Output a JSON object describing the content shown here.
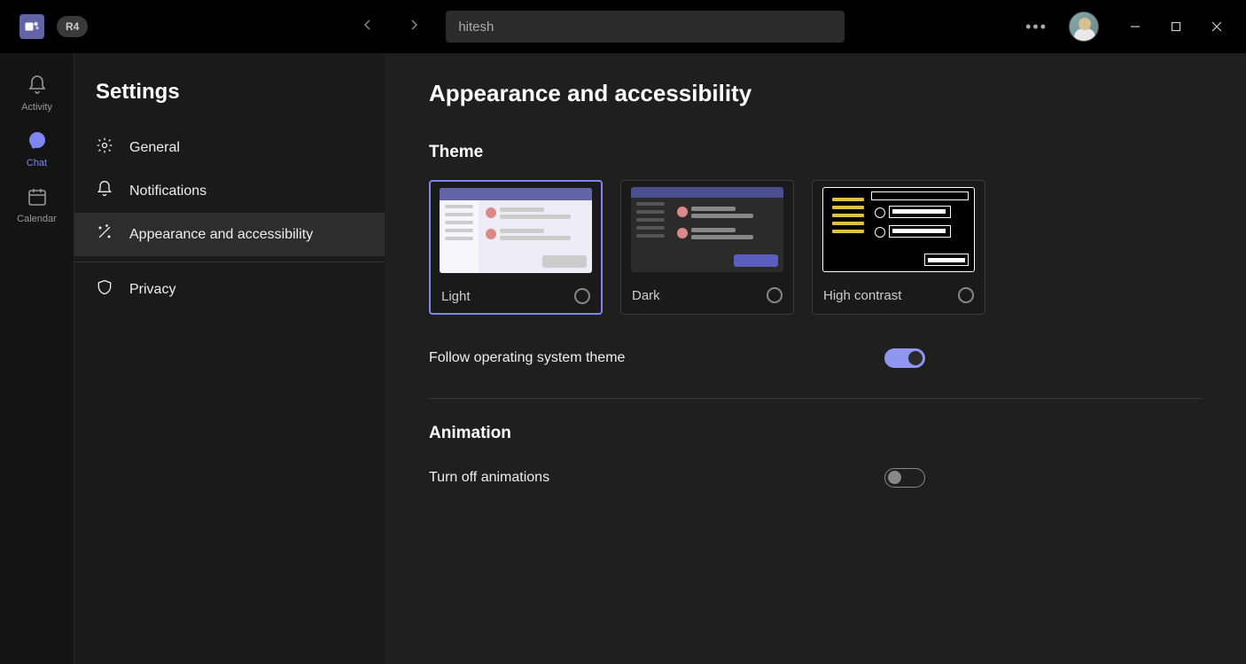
{
  "titlebar": {
    "org_badge": "R4",
    "search_value": "hitesh"
  },
  "rail": {
    "items": [
      {
        "id": "activity",
        "label": "Activity"
      },
      {
        "id": "chat",
        "label": "Chat"
      },
      {
        "id": "calendar",
        "label": "Calendar"
      }
    ],
    "active": "chat"
  },
  "settings": {
    "title": "Settings",
    "nav": [
      {
        "id": "general",
        "label": "General"
      },
      {
        "id": "notifications",
        "label": "Notifications"
      },
      {
        "id": "appearance",
        "label": "Appearance and accessibility"
      },
      {
        "id": "privacy",
        "label": "Privacy"
      }
    ],
    "active": "appearance"
  },
  "content": {
    "page_title": "Appearance and accessibility",
    "theme_section_title": "Theme",
    "themes": {
      "light": "Light",
      "dark": "Dark",
      "high_contrast": "High contrast"
    },
    "follow_os_label": "Follow operating system theme",
    "follow_os_on": true,
    "animation_section_title": "Animation",
    "turn_off_animations_label": "Turn off animations",
    "turn_off_animations_on": false
  },
  "colors": {
    "accent": "#7f85f5",
    "toggle_on": "#9096f0"
  }
}
